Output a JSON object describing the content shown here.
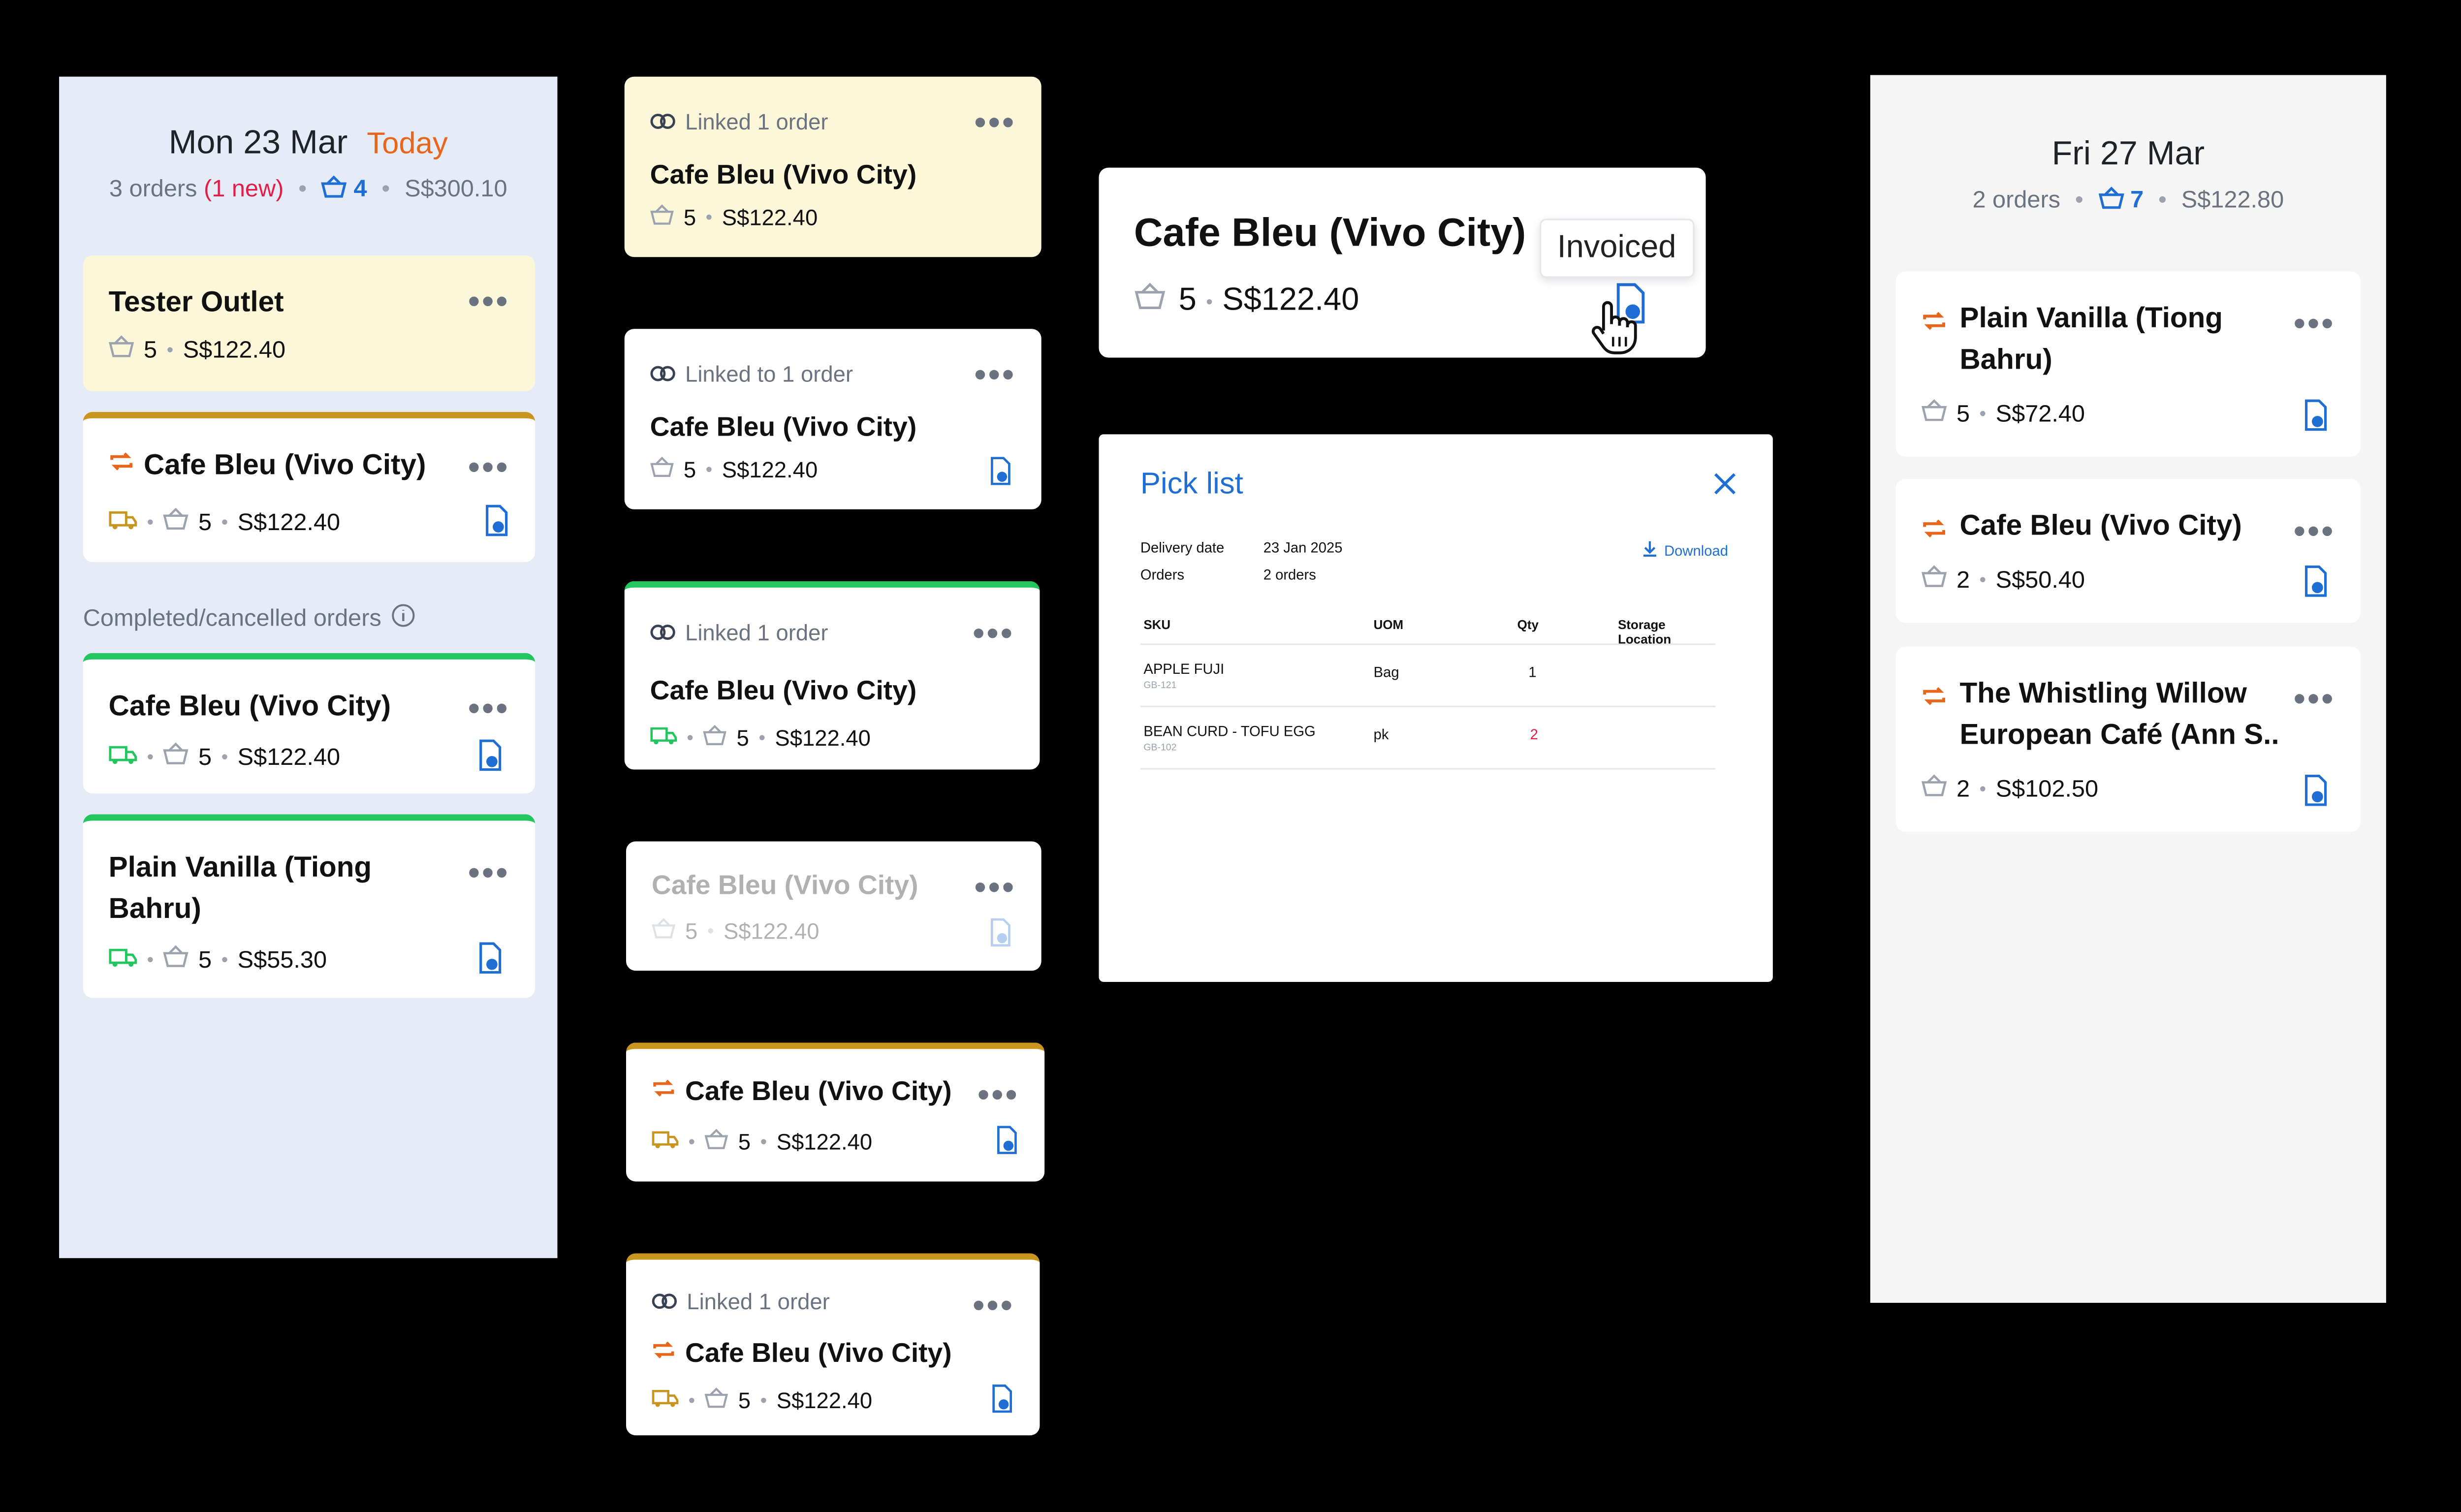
{
  "col1": {
    "day": "Mon 23 Mar",
    "today": "Today",
    "orders": "3 orders",
    "new": "(1 new)",
    "basket": "4",
    "total": "S$300.10",
    "completed_label": "Completed/cancelled orders",
    "cards": [
      {
        "title": "Tester Outlet",
        "qty": "5",
        "price": "S$122.40"
      },
      {
        "title": "Cafe Bleu (Vivo City)",
        "qty": "5",
        "price": "S$122.40"
      },
      {
        "title": "Cafe Bleu (Vivo City)",
        "qty": "5",
        "price": "S$122.40"
      },
      {
        "title": "Plain Vanilla (Tiong Bahru)",
        "qty": "5",
        "price": "S$55.30"
      }
    ]
  },
  "col2": {
    "cards": [
      {
        "link": "Linked 1 order",
        "title": "Cafe Bleu (Vivo City)",
        "qty": "5",
        "price": "S$122.40"
      },
      {
        "link": "Linked to 1 order",
        "title": "Cafe Bleu (Vivo City)",
        "qty": "5",
        "price": "S$122.40"
      },
      {
        "link": "Linked 1 order",
        "title": "Cafe Bleu (Vivo City)",
        "qty": "5",
        "price": "S$122.40"
      },
      {
        "title": "Cafe Bleu (Vivo City)",
        "qty": "5",
        "price": "S$122.40"
      },
      {
        "title": "Cafe Bleu (Vivo City)",
        "qty": "5",
        "price": "S$122.40"
      },
      {
        "link": "Linked 1 order",
        "title": "Cafe Bleu (Vivo City)",
        "qty": "5",
        "price": "S$122.40"
      }
    ]
  },
  "zoom_card": {
    "title": "Cafe Bleu (Vivo City)",
    "qty": "5",
    "price": "S$122.40",
    "tooltip": "Invoiced"
  },
  "pick_list": {
    "title": "Pick list",
    "delivery_label": "Delivery date",
    "delivery_value": "23 Jan 2025",
    "orders_label": "Orders",
    "orders_value": "2 orders",
    "download": "Download",
    "headers": [
      "SKU",
      "UOM",
      "Qty",
      "Storage Location"
    ],
    "rows": [
      {
        "sku": "APPLE FUJI",
        "code": "GB-121",
        "uom": "Bag",
        "qty": "1"
      },
      {
        "sku": "BEAN CURD - TOFU EGG",
        "code": "GB-102",
        "uom": "pk",
        "qty": "2"
      }
    ]
  },
  "col3": {
    "day": "Fri 27 Mar",
    "orders": "2 orders",
    "basket": "7",
    "total": "S$122.80",
    "cards": [
      {
        "title": "Plain Vanilla (Tiong Bahru)",
        "qty": "5",
        "price": "S$72.40"
      },
      {
        "title": "Cafe Bleu (Vivo City)",
        "qty": "2",
        "price": "S$50.40"
      },
      {
        "title": "The Whistling Willow European Café (Ann S..",
        "qty": "2",
        "price": "S$102.50"
      }
    ]
  },
  "colors": {
    "accent": "#1f6ed4",
    "orange": "#e8661c",
    "green": "#22c55e",
    "gold": "#c8961f",
    "red": "#e11d48"
  }
}
